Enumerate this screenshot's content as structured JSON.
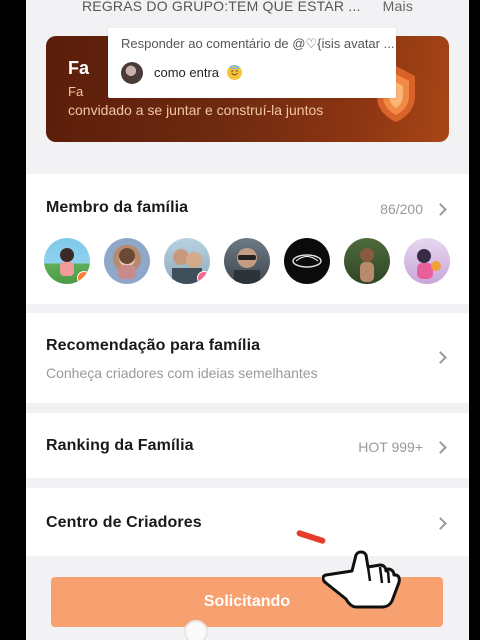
{
  "header": {
    "group_rules": "REGRAS DO GRUPO:TEM QUE ESTAR ...",
    "more_label": "Mais"
  },
  "banner": {
    "title": "Fa",
    "subtitle_1": "Fa",
    "subtitle_2": "convidado a se juntar e construí-la juntos"
  },
  "reply_popup": {
    "heading": "Responder ao comentário de @♡{isis avatar ...",
    "text": "como entra"
  },
  "family_members": {
    "title": "Membro da família",
    "count": "86/200"
  },
  "recommendation": {
    "title": "Recomendação para família",
    "subtitle": "Conheça criadores com ideias semelhantes"
  },
  "ranking": {
    "title": "Ranking da Família",
    "hot_label": "HOT 999+"
  },
  "creators": {
    "title": "Centro de Criadores"
  },
  "cta": {
    "label": "Solicitando"
  },
  "colors": {
    "accent": "#f8a170",
    "badge": "#fa7d3c",
    "banner_dark": "#5a1d0a"
  }
}
